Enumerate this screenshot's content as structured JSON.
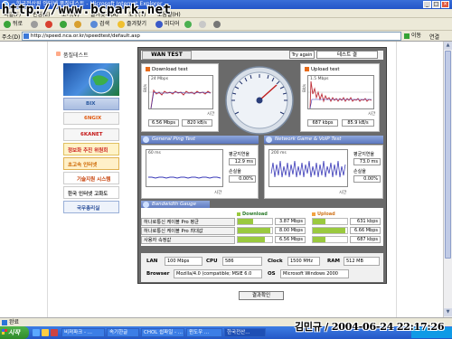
{
  "window": {
    "title": ": 한국전산원 인터넷 품질테스트 - Microsoft Internet Explorer",
    "watermark": "http://www.bcpark.net"
  },
  "menubar": {
    "items": [
      "파일(F)",
      "편집(E)",
      "보기(V)",
      "즐겨찾기(A)",
      "도구(T)",
      "도움말(H)"
    ]
  },
  "toolbar": {
    "back": "뒤로",
    "search": "검색",
    "favorites": "즐겨찾기",
    "media": "미디어"
  },
  "address": {
    "label": "주소(D)",
    "url": "http://speed.nca.or.kr/speedtest/default.asp",
    "go": "이동",
    "links": "연결"
  },
  "sidebar": {
    "heading": "품질테스트",
    "banners": [
      {
        "label": "BIX",
        "color": "#2c5aa0"
      },
      {
        "label": "6NGIX",
        "color": "#e05a12"
      },
      {
        "label": "6KANET",
        "color": "#c51818"
      },
      {
        "label": "정보화 추진 위원회",
        "color": "#cc2222"
      },
      {
        "label": "초고속 인터넷",
        "color": "#cc6600"
      },
      {
        "label": "기술지원 시스템",
        "color": "#c43a00"
      },
      {
        "label": "한국 인터넷 고화도",
        "color": "#333333"
      },
      {
        "label": "국무총리실",
        "color": "#2b4f9a"
      }
    ]
  },
  "app": {
    "tab": "WAN TEST",
    "try_again": "Try again",
    "date": "테스트 결",
    "download": {
      "title": "Download test",
      "scale": "24 Mbps",
      "value1": "6.56 Mbps",
      "value2": "820 kB/s",
      "x_label": "시간",
      "y_label": "Bit/s"
    },
    "upload": {
      "title": "Upload test",
      "scale": "1.5 Mbps",
      "value1": "687 kbps",
      "value2": "85.9 kB/s",
      "x_label": "시간",
      "y_label": "Bit/s"
    },
    "general_ping": {
      "title": "General Ping Test",
      "scale": "60 ms",
      "avg_label": "평균지연율",
      "avg_value": "12.9 ms",
      "loss_label": "손실율",
      "loss_value": "0.00%",
      "x_label": "시간"
    },
    "game_ping": {
      "title": "Network Game & VoIP Test",
      "scale": "200 ms",
      "avg_label": "평균지연율",
      "avg_value": "73.0 ms",
      "loss_label": "손실율",
      "loss_value": "0.00%",
      "x_label": "시간"
    },
    "bandwidth": {
      "title": "Bandwidth Gauge",
      "download_header": "Download",
      "upload_header": "Upload",
      "rows": [
        {
          "label": "하나로통신 케이블 Pro 평균",
          "down": "3.87 Mbps",
          "down_pct": 0.46,
          "up": "631 kbps",
          "up_pct": 0.36
        },
        {
          "label": "하나로통신 케이블 Pro 최대값",
          "down": "8.00 Mbps",
          "down_pct": 0.96,
          "up": "6.66 Mbps",
          "up_pct": 0.95
        },
        {
          "label": "사용자 속정값",
          "down": "6.56 Mbps",
          "down_pct": 0.8,
          "up": "687 kbps",
          "up_pct": 0.38
        }
      ]
    },
    "system": {
      "lan_key": "LAN",
      "lan": "100 Mbps",
      "cpu_key": "CPU",
      "cpu": "586",
      "clock_key": "Clock",
      "clock": "1500 MHz",
      "ram_key": "RAM",
      "ram": "512 MB",
      "browser_key": "Browser",
      "browser": "Mozilla/4.0 (compatible; MSIE 6.0",
      "os_key": "OS",
      "os": "Microsoft Windows 2000"
    },
    "result_button": "결과확인"
  },
  "statusbar": {
    "text": "완료"
  },
  "taskbar": {
    "start": "시작",
    "items": [
      {
        "label": "비져파크 - ...",
        "active": false
      },
      {
        "label": "속기한글",
        "active": false
      },
      {
        "label": "CHOL 쉽파일 - ...",
        "active": false
      },
      {
        "label": "윈도우 ...",
        "active": false
      },
      {
        "label": "한국전산...",
        "active": true
      }
    ]
  },
  "overlay_timestamp": "김민규 / 2004-06-24 22:17:26",
  "colors": {
    "download_line": "#c0303a",
    "ping_line": "#3a3ab8",
    "accent_green": "#9ac93f",
    "accent_orange": "#f2a341"
  }
}
